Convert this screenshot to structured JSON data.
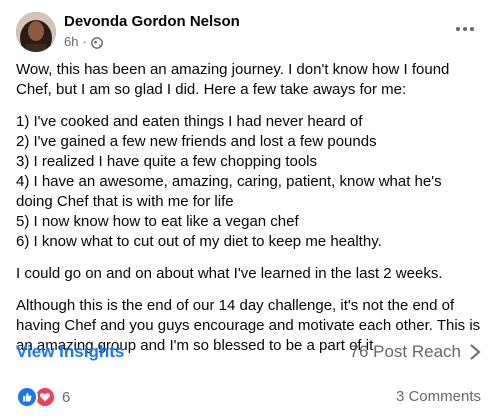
{
  "post": {
    "author": "Devonda Gordon Nelson",
    "time": "6h",
    "separator": "·",
    "audience_icon": "globe-icon",
    "more_icon": "more-horizontal-icon",
    "body": {
      "intro": [
        "Wow, this has been an amazing journey.  I don't know how I found",
        "Chef, but I am so glad I did.  Here a few take aways for me:"
      ],
      "list": [
        "1)  I've cooked and eaten things I had never heard of",
        "2)  I've gained a few new friends and lost a few pounds",
        "3) I realized I have quite a few chopping tools",
        "4)  I have an awesome, amazing, caring, patient,  know what he's",
        "doing Chef that is with me for life",
        "5) I now know how to eat like a vegan chef",
        "6)  I know what to cut out of my diet to keep me healthy."
      ],
      "learned": "I could go on and on about what I've learned in the last 2 weeks.",
      "closing": [
        "Although this is the end of our 14 day challenge, it's not the end of",
        "having Chef and you guys encourage and motivate each other.  This is",
        "an amazing group and I'm so blessed to be a part of it."
      ]
    },
    "insights": {
      "view_label": "View Insights",
      "reach_label": "76 Post Reach",
      "chevron_icon": "chevron-right-icon"
    },
    "reactions": {
      "icons": [
        "like-icon",
        "love-icon"
      ],
      "count": "6",
      "comments_label": "3 Comments"
    },
    "colors": {
      "link_blue": "#1877f2",
      "secondary_text": "#65676b",
      "love_red": "#f33e58"
    }
  }
}
